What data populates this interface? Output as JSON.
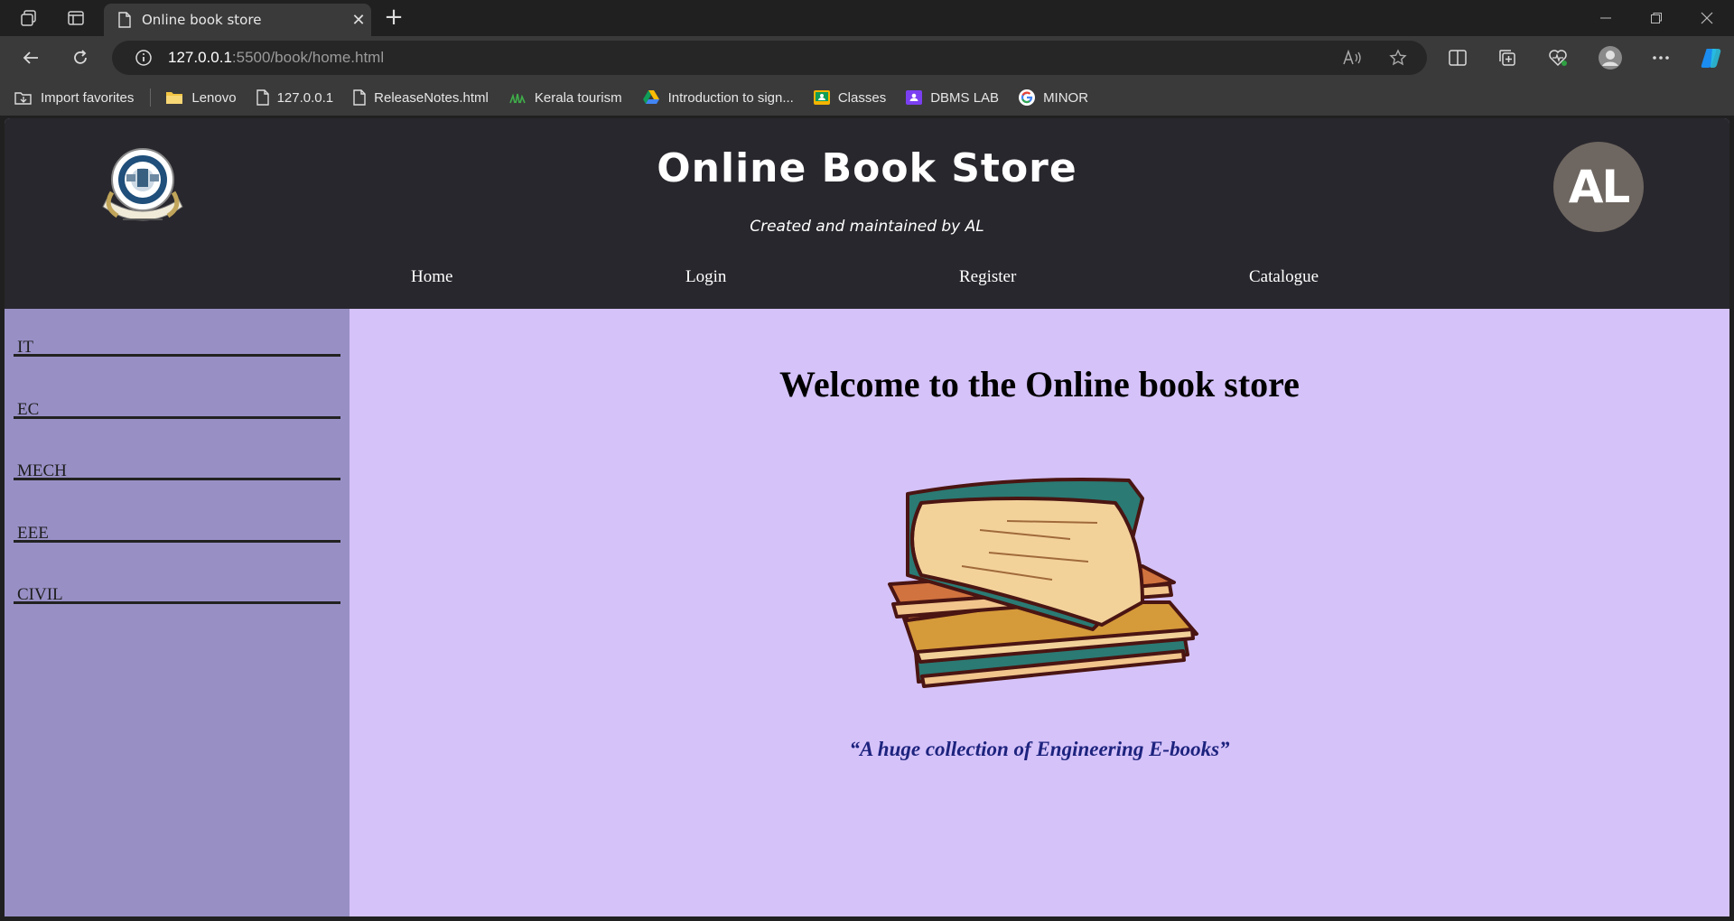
{
  "browser": {
    "tab": {
      "title": "Online book store",
      "close": "✕"
    },
    "new_tab": "+",
    "url": {
      "host": "127.0.0.1",
      "path": ":5500/book/home.html"
    },
    "bookmarks": [
      {
        "label": "Import favorites",
        "icon": "import-icon"
      },
      {
        "label": "Lenovo",
        "icon": "folder-icon"
      },
      {
        "label": "127.0.0.1",
        "icon": "page-icon"
      },
      {
        "label": "ReleaseNotes.html",
        "icon": "page-icon"
      },
      {
        "label": "Kerala tourism",
        "icon": "kerala-icon"
      },
      {
        "label": "Introduction to sign...",
        "icon": "drive-icon"
      },
      {
        "label": "Classes",
        "icon": "classroom-icon"
      },
      {
        "label": "DBMS LAB",
        "icon": "classroom-icon"
      },
      {
        "label": "MINOR",
        "icon": "google-icon"
      }
    ]
  },
  "site": {
    "title": "Online Book Store",
    "subtitle": "Created and maintained by AL",
    "avatar": "AL",
    "nav": [
      "Home",
      "Login",
      "Register",
      "Catalogue"
    ]
  },
  "sidebar": {
    "items": [
      "IT",
      "EC",
      "MECH",
      "EEE",
      "CIVIL"
    ]
  },
  "main": {
    "heading": "Welcome to the Online book store",
    "tagline": "“A huge collection of Engineering E-books”"
  },
  "colors": {
    "header_bg": "#28272d",
    "sidebar_bg": "#9890c5",
    "main_bg": "#d5c2f9",
    "tagline": "#1d237e"
  }
}
